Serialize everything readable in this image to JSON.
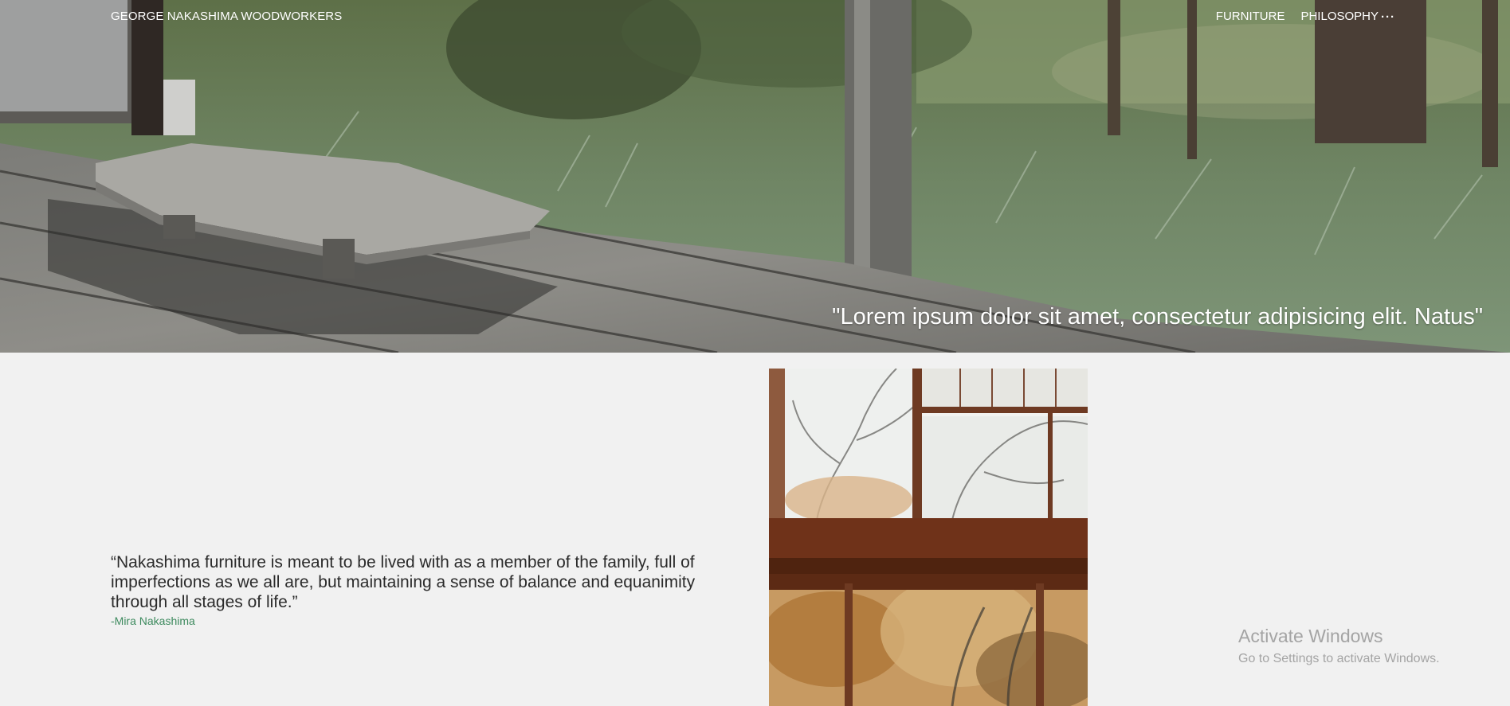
{
  "nav": {
    "brand": "GEORGE NAKASHIMA WOODWORKERS",
    "links": [
      {
        "label": "FURNITURE"
      },
      {
        "label": "PHILOSOPHY"
      }
    ],
    "more_icon": "more-horizontal-icon",
    "more_label": "···"
  },
  "hero": {
    "quote": "\"Lorem ipsum dolor sit amet, consectetur adipisicing elit. Natus\""
  },
  "main": {
    "quote": "“Nakashima furniture is meant to be lived with as a member of the family, full of imperfections as we all are, but maintaining a sense of balance and equanimity through all stages of life.”",
    "author": "-Mira Nakashima"
  },
  "overlay": {
    "title": "Activate Windows",
    "subtitle": "Go to Settings to activate Windows."
  },
  "colors": {
    "background": "#f1f1f1",
    "accent_green": "#3d8a5e",
    "text_dark": "#2b2b2b"
  }
}
